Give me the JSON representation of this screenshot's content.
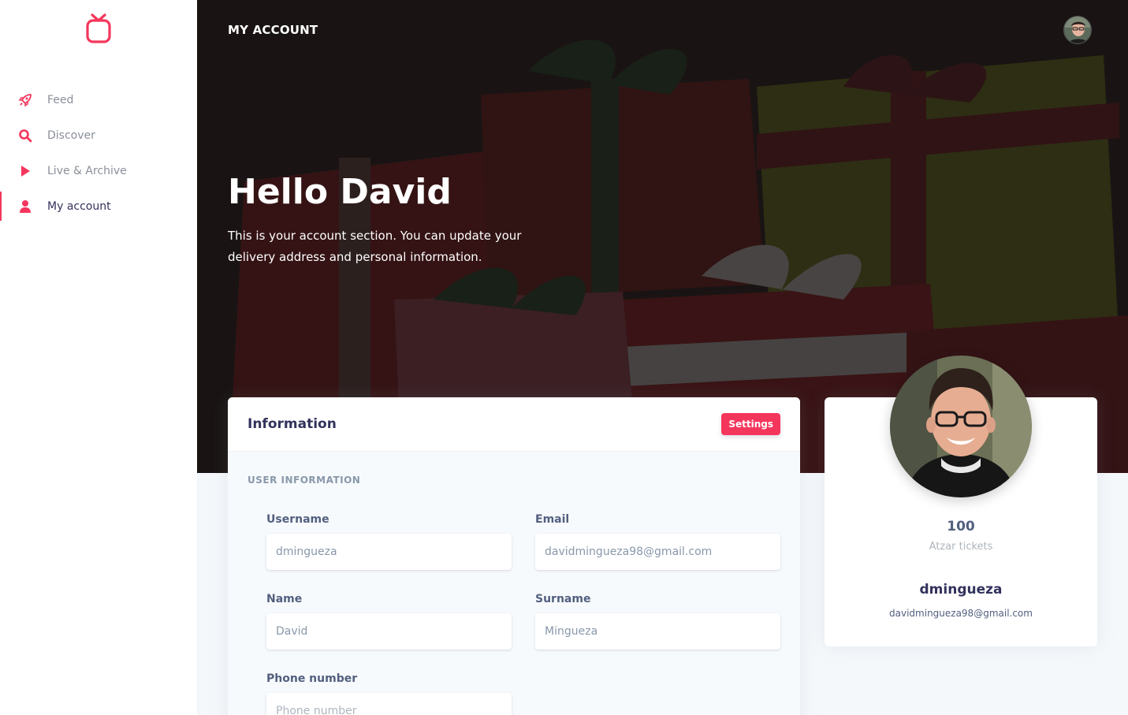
{
  "app": {
    "brand_color": "#f5365c"
  },
  "sidebar": {
    "items": [
      {
        "label": "Feed",
        "icon": "rocket-icon"
      },
      {
        "label": "Discover",
        "icon": "search-icon"
      },
      {
        "label": "Live & Archive",
        "icon": "play-icon"
      },
      {
        "label": "My account",
        "icon": "user-icon",
        "active": true
      }
    ]
  },
  "header": {
    "title": "MY ACCOUNT"
  },
  "hero": {
    "title": "Hello David",
    "text": "This is your account section. You can update your delivery address and personal information."
  },
  "info_card": {
    "title": "Information",
    "settings_label": "Settings",
    "section_label": "USER INFORMATION",
    "fields": {
      "username": {
        "label": "Username",
        "value": "dmingueza"
      },
      "email": {
        "label": "Email",
        "value": "davidmingueza98@gmail.com"
      },
      "name": {
        "label": "Name",
        "value": "David"
      },
      "surname": {
        "label": "Surname",
        "value": "Mingueza"
      },
      "phone": {
        "label": "Phone number",
        "placeholder": "Phone number"
      }
    }
  },
  "profile": {
    "tickets_count": "100",
    "tickets_label": "Atzar tickets",
    "username": "dmingueza",
    "email": "davidmingueza98@gmail.com"
  }
}
